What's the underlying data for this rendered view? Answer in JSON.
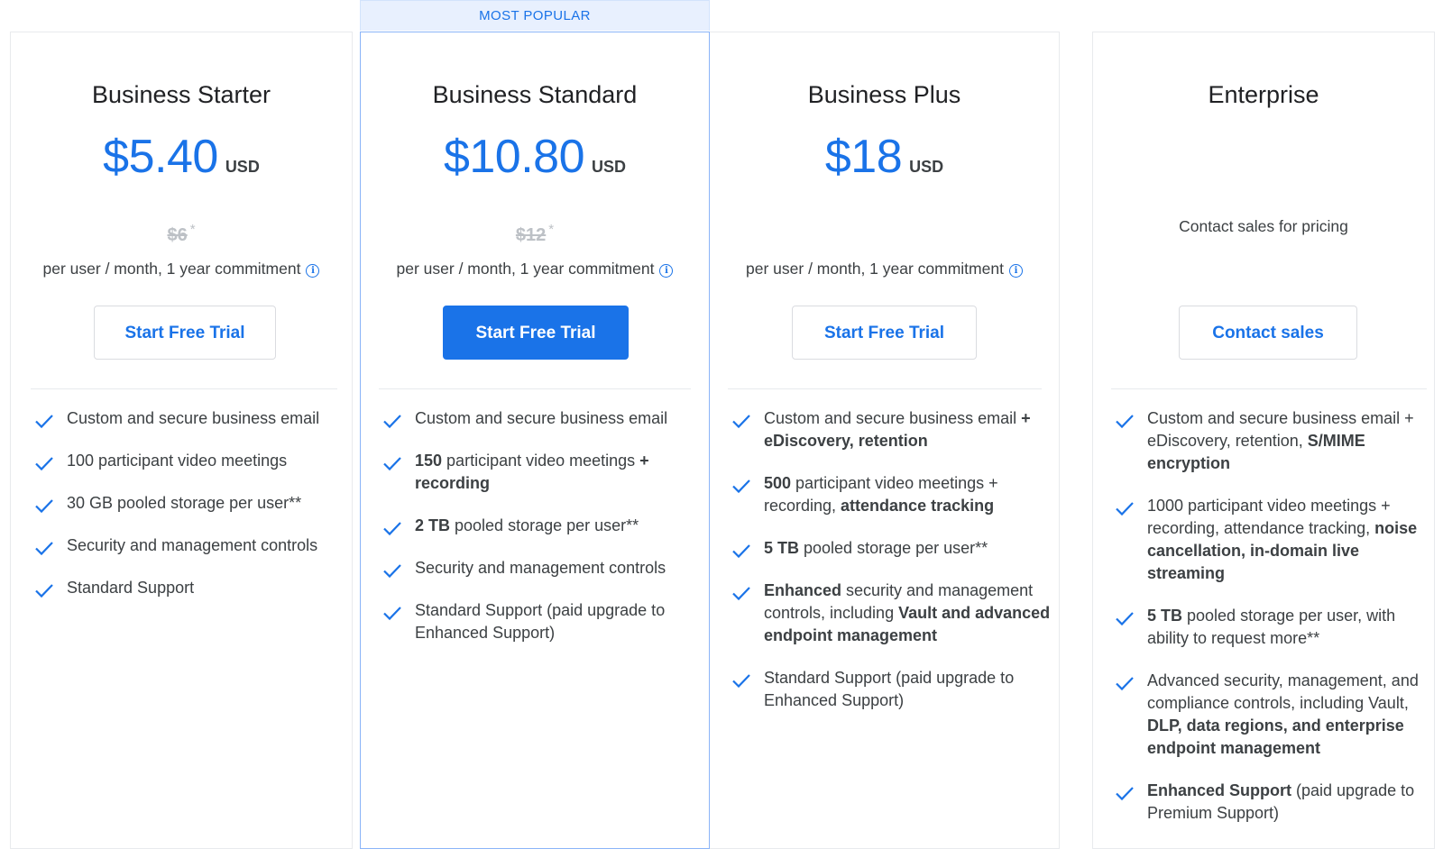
{
  "badge": "MOST POPULAR",
  "colors": {
    "accent": "#1a73e8",
    "badge_bg": "#e8f0fe",
    "text": "#3c4043",
    "muted": "#bdc1c6",
    "border": "#e8eaed"
  },
  "icons": {
    "check": "check-icon",
    "info": "info-icon"
  },
  "plans": [
    {
      "name": "Business Starter",
      "price": "$5.40",
      "currency": "USD",
      "old_price": "$6",
      "old_price_mark": "*",
      "period": "per user / month, 1 year commitment",
      "cta": "Start Free Trial",
      "features": [
        [
          {
            "t": "Custom and secure business email",
            "b": false
          }
        ],
        [
          {
            "t": "100 participant video meetings",
            "b": false
          }
        ],
        [
          {
            "t": "30 GB pooled storage per user**",
            "b": false
          }
        ],
        [
          {
            "t": "Security and management controls",
            "b": false
          }
        ],
        [
          {
            "t": "Standard Support",
            "b": false
          }
        ]
      ]
    },
    {
      "name": "Business Standard",
      "price": "$10.80",
      "currency": "USD",
      "old_price": "$12",
      "old_price_mark": "*",
      "period": "per user / month, 1 year commitment",
      "cta": "Start Free Trial",
      "features": [
        [
          {
            "t": "Custom and secure business email",
            "b": false
          }
        ],
        [
          {
            "t": "150",
            "b": true
          },
          {
            "t": " participant video meetings ",
            "b": false
          },
          {
            "t": "+ recording",
            "b": true
          }
        ],
        [
          {
            "t": "2 TB",
            "b": true
          },
          {
            "t": " pooled storage per user**",
            "b": false
          }
        ],
        [
          {
            "t": "Security and management controls",
            "b": false
          }
        ],
        [
          {
            "t": "Standard Support (paid upgrade to Enhanced Support)",
            "b": false
          }
        ]
      ]
    },
    {
      "name": "Business Plus",
      "price": "$18",
      "currency": "USD",
      "period": "per user / month, 1 year commitment",
      "cta": "Start Free Trial",
      "features": [
        [
          {
            "t": "Custom and secure business email ",
            "b": false
          },
          {
            "t": "+ eDiscovery, retention",
            "b": true
          }
        ],
        [
          {
            "t": "500",
            "b": true
          },
          {
            "t": " participant video meetings + recording, ",
            "b": false
          },
          {
            "t": "attendance tracking",
            "b": true
          }
        ],
        [
          {
            "t": "5 TB",
            "b": true
          },
          {
            "t": " pooled storage per user**",
            "b": false
          }
        ],
        [
          {
            "t": "Enhanced",
            "b": true
          },
          {
            "t": " security and management controls, including ",
            "b": false
          },
          {
            "t": "Vault and advanced endpoint management",
            "b": true
          }
        ],
        [
          {
            "t": "Standard Support (paid upgrade to Enhanced Support)",
            "b": false
          }
        ]
      ]
    },
    {
      "name": "Enterprise",
      "contact_text": "Contact sales for pricing",
      "cta": "Contact sales",
      "features": [
        [
          {
            "t": "Custom and secure business email + eDiscovery, retention, ",
            "b": false
          },
          {
            "t": "S/MIME encryption",
            "b": true
          }
        ],
        [
          {
            "t": "1000 participant video meetings + recording, attendance tracking, ",
            "b": false
          },
          {
            "t": "noise cancellation, in-domain live streaming",
            "b": true
          }
        ],
        [
          {
            "t": "5 TB",
            "b": true
          },
          {
            "t": " pooled storage per user, with ability to request more**",
            "b": false
          }
        ],
        [
          {
            "t": "Advanced security, management, and compliance controls, including Vault, ",
            "b": false
          },
          {
            "t": "DLP, data regions, and enterprise endpoint management",
            "b": true
          }
        ],
        [
          {
            "t": "Enhanced Support",
            "b": true
          },
          {
            "t": " (paid upgrade to Premium Support)",
            "b": false
          }
        ]
      ]
    }
  ]
}
